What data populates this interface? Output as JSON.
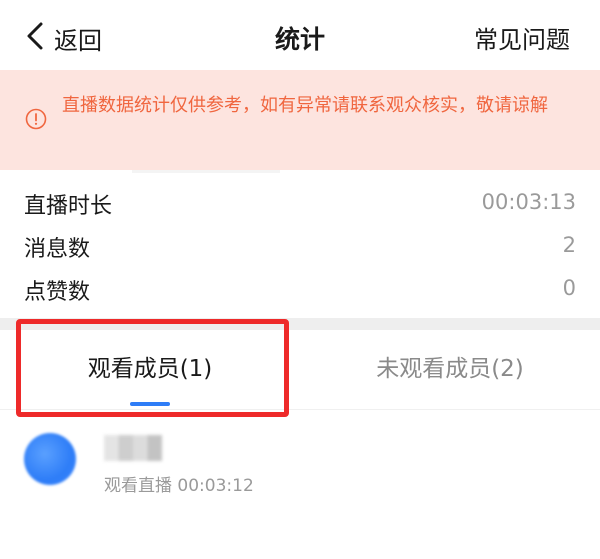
{
  "header": {
    "back_label": "返回",
    "title": "统计",
    "faq_label": "常见问题"
  },
  "notice": {
    "text": "直播数据统计仅供参考，如有异常请联系观众核实，敬请谅解",
    "color": "#f0663f",
    "background": "#fde4df"
  },
  "stats": [
    {
      "label": "直播时长",
      "value": "00:03:13"
    },
    {
      "label": "消息数",
      "value": "2"
    },
    {
      "label": "点赞数",
      "value": "0"
    }
  ],
  "tabs": [
    {
      "label": "观看成员(1)",
      "active": true
    },
    {
      "label": "未观看成员(2)",
      "active": false
    }
  ],
  "members": [
    {
      "status": "观看直播 00:03:12"
    }
  ],
  "colors": {
    "accent": "#2e7df7",
    "highlight": "#ee2a2a"
  }
}
